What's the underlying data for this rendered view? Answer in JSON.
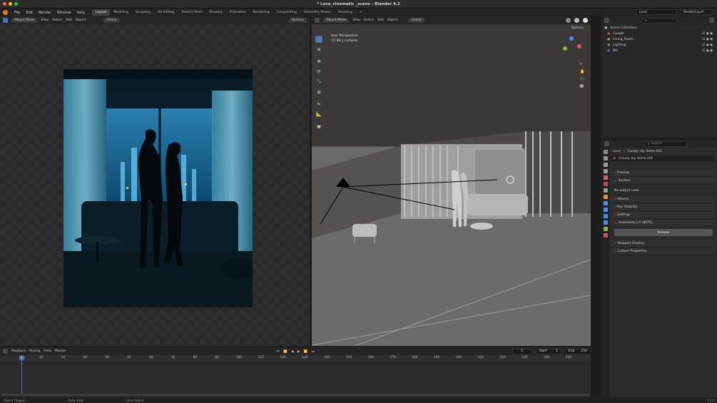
{
  "window": {
    "title": "* Love_cinematic _scene - Blender 4.2",
    "traffic_colors": [
      "#ff5f57",
      "#febc2e",
      "#28c840"
    ]
  },
  "menu": [
    "File",
    "Edit",
    "Render",
    "Window",
    "Help"
  ],
  "workspaces": [
    "Layout",
    "Modeling",
    "Sculpting",
    "UV Editing",
    "Texture Paint",
    "Shading",
    "Animation",
    "Rendering",
    "Compositing",
    "Geometry Nodes",
    "Scripting"
  ],
  "active_workspace": "Layout",
  "scene_name": "Love",
  "view_layer": "RenderLayer",
  "image_editor": {
    "mode": "Object Mode",
    "menus": [
      "View",
      "Select",
      "Add",
      "Object"
    ],
    "transform": "Global",
    "options": "Options"
  },
  "viewport": {
    "mode": "Object Mode",
    "menus": [
      "View",
      "Select",
      "Add",
      "Object"
    ],
    "transform": "Global",
    "perspective_label": "User Perspective",
    "selection_label": "(1) BG | curtaine",
    "options": "Options"
  },
  "outliner": {
    "search_placeholder": "",
    "root": "Scene Collection",
    "collections": [
      "Couple",
      "Living_Room",
      "Lighting",
      "BG"
    ]
  },
  "properties": {
    "search_placeholder": "Search",
    "breadcrumb": [
      "Love",
      "Cloudy sky dome.001"
    ],
    "world_name": "Cloudy sky dome.001",
    "sections": {
      "preview": "Preview",
      "surface": "Surface",
      "no_output": "No output node",
      "volume": "Volume",
      "ray_visibility": "Ray Visibility",
      "settings": "Settings",
      "addon": "materialiq 5.0 (BETA)",
      "browse": "Browse",
      "viewport_display": "Viewport Display",
      "custom_properties": "Custom Properties"
    }
  },
  "timeline": {
    "menus": [
      "Playback",
      "Keying",
      "View",
      "Marker"
    ],
    "current_frame": "1",
    "start_label": "Start",
    "start": "1",
    "end_label": "End",
    "end": "250",
    "ticks": [
      "1",
      "10",
      "20",
      "30",
      "40",
      "50",
      "60",
      "70",
      "80",
      "90",
      "100",
      "110",
      "120",
      "130",
      "140",
      "150",
      "160",
      "170",
      "180",
      "190",
      "200",
      "210",
      "220",
      "230",
      "240",
      "250"
    ]
  },
  "statusbar": {
    "select": "Select (Toggle)",
    "dolly": "Dolly View",
    "lasso": "Lasso Select",
    "version": "4.2.0"
  },
  "colors": {
    "accent": "#4772b3",
    "header_bg": "#252525",
    "panel_bg": "#2b2b2b",
    "blender_orange": "#e87d0d"
  }
}
